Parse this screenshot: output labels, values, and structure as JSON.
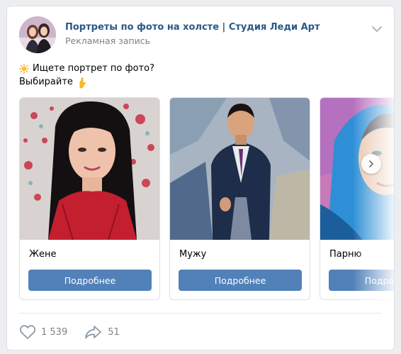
{
  "post": {
    "author": "Портреты по фото на холсте | Студия Леди Арт",
    "ad_label": "Рекламная запись",
    "text_line1": "Ищете портрет по фото?",
    "text_line2": "Выбирайте",
    "emoji1": "sun-icon",
    "emoji2": "pointing-down-icon"
  },
  "carousel": {
    "cards": [
      {
        "title": "Жене",
        "button": "Подробнее",
        "image": "woman-portrait-painting"
      },
      {
        "title": "Мужу",
        "button": "Подробнее",
        "image": "man-in-coat-portrait-painting"
      },
      {
        "title": "Парню",
        "button": "Подробнее",
        "image": "young-man-hood-portrait-painting"
      }
    ],
    "next_icon": "chevron-right-icon"
  },
  "footer": {
    "likes": "1 539",
    "shares": "51",
    "like_icon": "heart-icon",
    "share_icon": "share-arrow-icon"
  },
  "colors": {
    "link": "#2a5885",
    "button": "#5181b8",
    "muted": "#828282",
    "background": "#edeef0"
  }
}
